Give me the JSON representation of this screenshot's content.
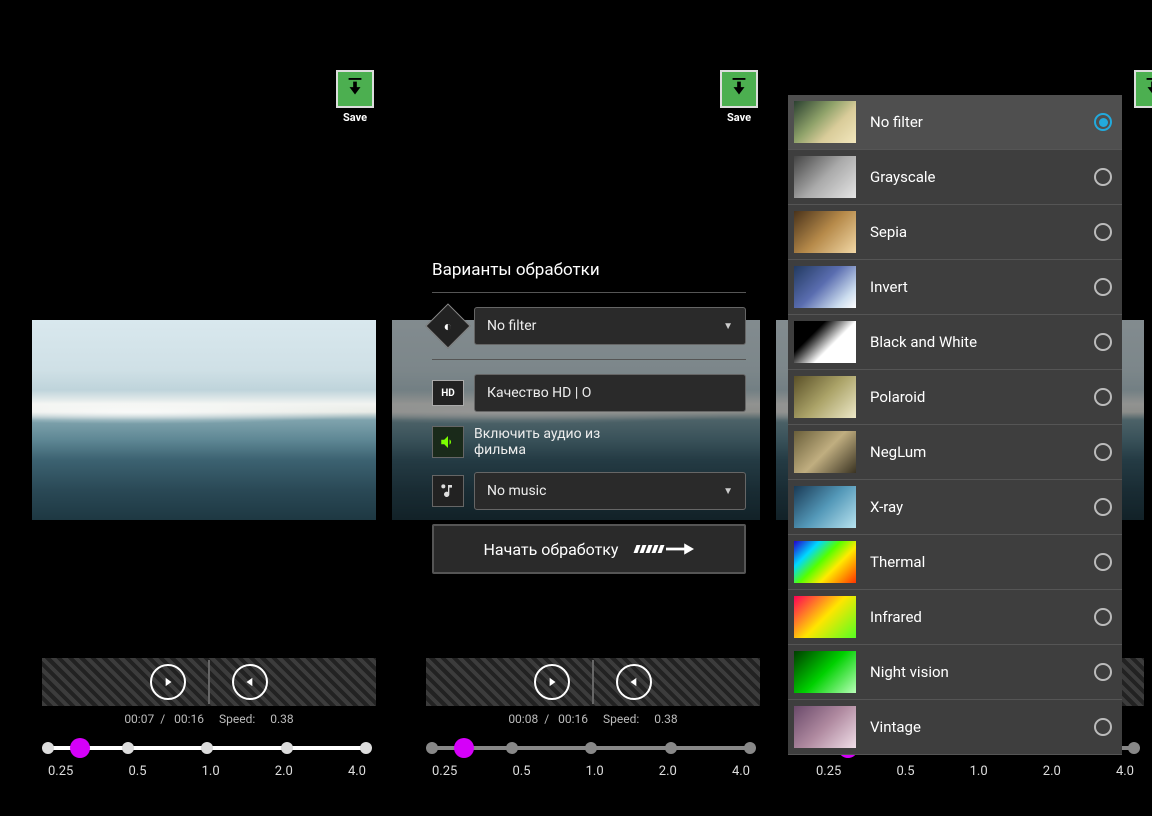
{
  "save_label": "Save",
  "dialog": {
    "title": "Варианты обработки",
    "filter_label": "No filter",
    "quality_label": "Качество HD | О",
    "audio_line1": "Включить аудио из",
    "audio_line2": "фильма",
    "music_label": "No music",
    "start_label": "Начать обработку",
    "hd_icon_text": "HD"
  },
  "timelines": [
    {
      "position": "00:07",
      "duration": "00:16",
      "speed_prefix": "Speed:",
      "speed": "0.38",
      "thumb_pct": 10,
      "track_grey": false
    },
    {
      "position": "00:08",
      "duration": "00:16",
      "speed_prefix": "Speed:",
      "speed": "0.38",
      "thumb_pct": 10,
      "track_grey": true
    },
    {
      "position": "",
      "duration": "",
      "speed_prefix": "",
      "speed": "",
      "thumb_pct": 10,
      "track_grey": true
    }
  ],
  "speed_marks": [
    "0.25",
    "0.5",
    "1.0",
    "2.0",
    "4.0"
  ],
  "tick_positions": [
    0,
    25,
    50,
    75,
    100
  ],
  "filters": [
    {
      "name": "No filter",
      "swatch": "sw-default",
      "selected": true
    },
    {
      "name": "Grayscale",
      "swatch": "sw-gray",
      "selected": false
    },
    {
      "name": "Sepia",
      "swatch": "sw-sepia",
      "selected": false
    },
    {
      "name": "Invert",
      "swatch": "sw-invert",
      "selected": false
    },
    {
      "name": "Black and White",
      "swatch": "sw-bw",
      "selected": false
    },
    {
      "name": "Polaroid",
      "swatch": "sw-polaroid",
      "selected": false
    },
    {
      "name": "NegLum",
      "swatch": "sw-neglum",
      "selected": false
    },
    {
      "name": "X-ray",
      "swatch": "sw-xray",
      "selected": false
    },
    {
      "name": "Thermal",
      "swatch": "sw-thermal",
      "selected": false
    },
    {
      "name": "Infrared",
      "swatch": "sw-infrared",
      "selected": false
    },
    {
      "name": "Night vision",
      "swatch": "sw-nightv",
      "selected": false
    },
    {
      "name": "Vintage",
      "swatch": "sw-vintage",
      "selected": false
    }
  ]
}
